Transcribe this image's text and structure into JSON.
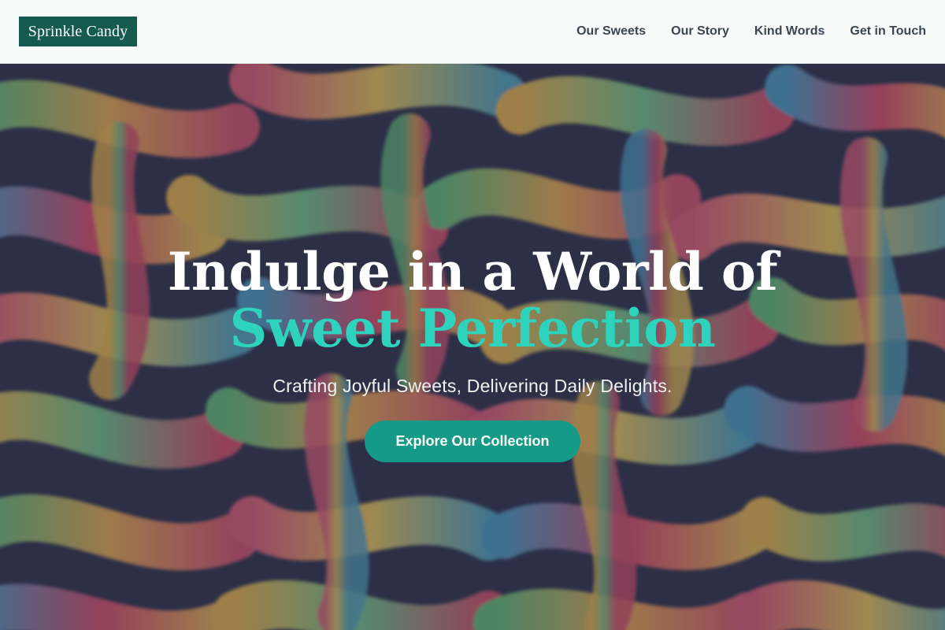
{
  "header": {
    "logo_text": "Sprinkle Candy",
    "nav": [
      {
        "label": "Our Sweets"
      },
      {
        "label": "Our Story"
      },
      {
        "label": "Kind Words"
      },
      {
        "label": "Get in Touch"
      }
    ]
  },
  "hero": {
    "background_image": "sour-gummy-worms-photo",
    "title_line1": "Indulge in a World of",
    "title_line2": "Sweet Perfection",
    "subtitle": "Crafting Joyful Sweets, Delivering Daily Delights.",
    "cta_label": "Explore Our Collection"
  },
  "colors": {
    "logo_bg": "#145a4e",
    "header_bg": "#f7fbfa",
    "nav_text": "#3a4651",
    "accent_teal": "#2ed3bd",
    "button_bg": "#169a88"
  }
}
